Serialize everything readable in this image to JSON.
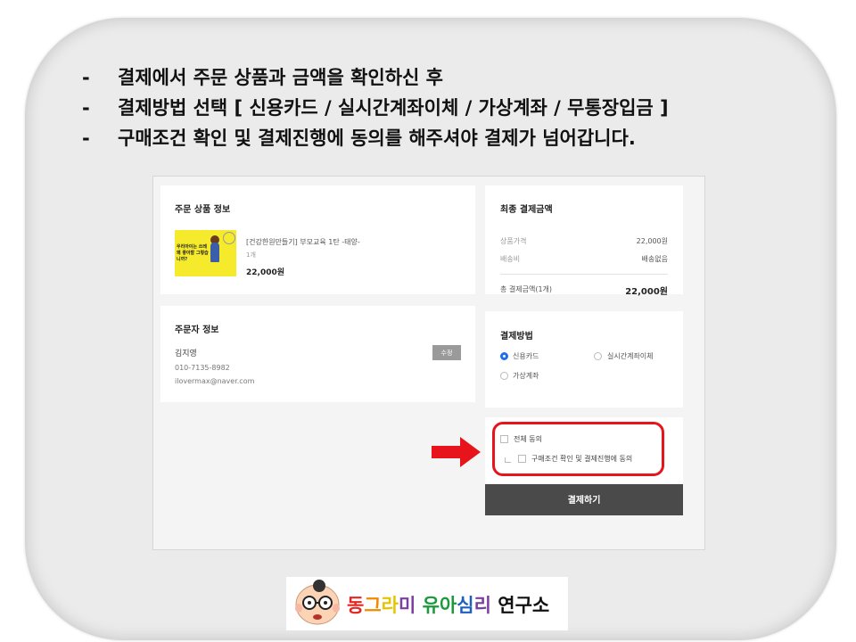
{
  "instructions": [
    {
      "dash": "-",
      "text": "결제에서 주문 상품과 금액을 확인하신 후"
    },
    {
      "dash": "-",
      "text": "결제방법 선택 [ 신용카드 / 실시간계좌이체 / 가상계좌 / 무통장입금 ]"
    },
    {
      "dash": "-",
      "text": "구매조건 확인 및 결제진행에 동의를 해주셔야 결제가 넘어갑니다."
    }
  ],
  "order": {
    "title": "주문 상품 정보",
    "thumbnail_text": "우리아이는 쓰레 왜 좋아할 그렇습니까?",
    "product_name": "[건강한원만들기] 부모교육 1탄 -태양-",
    "quantity": "1개",
    "price": "22,000원"
  },
  "orderer": {
    "title": "주문자 정보",
    "name": "김지영",
    "phone": "010-7135-8982",
    "email": "ilovermax@naver.com",
    "edit_label": "수정"
  },
  "summary": {
    "title": "최종 결제금액",
    "product_price_label": "상품가격",
    "product_price_value": "22,000원",
    "shipping_label": "배송비",
    "shipping_value": "배송없음",
    "total_label": "총 결제금액(1개)",
    "total_value": "22,000원"
  },
  "payment": {
    "title": "결제방법",
    "options": [
      "신용카드",
      "실시간계좌이체",
      "가상계좌"
    ],
    "selected": "신용카드"
  },
  "agreement": {
    "all_label": "전체 동의",
    "terms_label": "구매조건 확인 및 결제진행에 동의"
  },
  "pay_button": "결제하기",
  "logo": {
    "parts": [
      "동",
      "그",
      "라",
      "미",
      " ",
      "유",
      "아",
      "심",
      "리",
      " ",
      "연구소"
    ],
    "colors": [
      "#e52521",
      "#f08a00",
      "#e6c400",
      "#7a3fa0",
      "#000000",
      "#1a9a3a",
      "#1a9a3a",
      "#1d5fbf",
      "#7a3fa0",
      "#000000",
      "#111111"
    ]
  },
  "colors": {
    "highlight": "#e8141c",
    "selected_radio": "#1f6feb",
    "pay_button_bg": "#4a4a4a"
  }
}
